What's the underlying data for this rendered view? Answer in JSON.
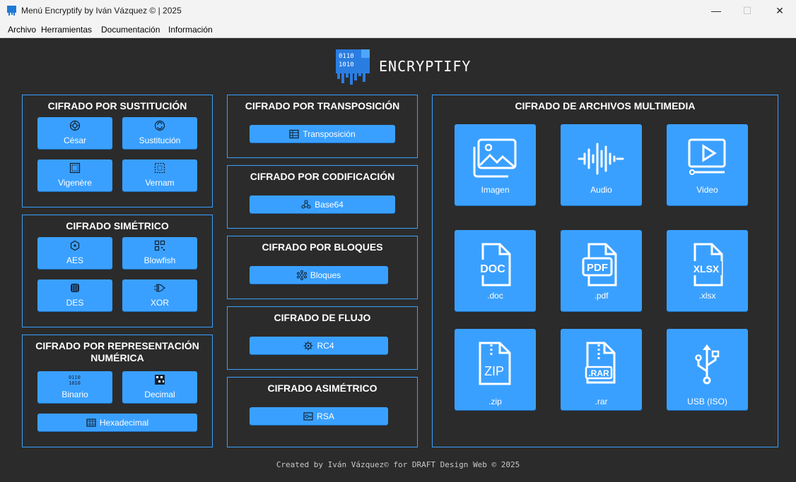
{
  "window": {
    "title": "Menú Encryptify by Iván Vázquez © | 2025",
    "minimize": "—",
    "maximize": "☐",
    "close": "✕"
  },
  "menu": [
    "Archivo",
    "Herramientas",
    "Documentación",
    "Información"
  ],
  "brand": "ENCRYPTIFY",
  "panels": {
    "sustitucion": {
      "title": "CIFRADO POR SUSTITUCIÓN",
      "buttons": [
        "César",
        "Sustitución",
        "Vigenère",
        "Vernam"
      ]
    },
    "simetrico": {
      "title": "CIFRADO SIMÉTRICO",
      "buttons": [
        "AES",
        "Blowfish",
        "DES",
        "XOR"
      ]
    },
    "numerica": {
      "title_line1": "CIFRADO POR REPRESENTACIÓN",
      "title_line2": "NUMÉRICA",
      "buttons": [
        "Binario",
        "Decimal",
        "Hexadecimal"
      ]
    },
    "transposicion": {
      "title": "CIFRADO POR TRANSPOSICIÓN",
      "button": "Transposición"
    },
    "codificacion": {
      "title": "CIFRADO POR CODIFICACIÓN",
      "button": "Base64"
    },
    "bloques": {
      "title": "CIFRADO POR BLOQUES",
      "button": "Bloques"
    },
    "flujo": {
      "title": "CIFRADO DE FLUJO",
      "button": "RC4"
    },
    "asimetrico": {
      "title": "CIFRADO ASIMÉTRICO",
      "button": "RSA"
    },
    "multimedia": {
      "title": "CIFRADO DE ARCHIVOS MULTIMEDIA",
      "buttons": [
        "Imagen",
        "Audio",
        "Video",
        ".doc",
        ".pdf",
        ".xlsx",
        ".zip",
        ".rar",
        "USB (ISO)"
      ]
    }
  },
  "file_icon_labels": {
    "doc": "DOC",
    "pdf": "PDF",
    "xlsx": "XLSX",
    "zip": "ZIP",
    "rar": ".RAR"
  },
  "footer": "Created by Iván Vázquez© for DRAFT Design Web © 2025",
  "colors": {
    "accent": "#3aa0ff",
    "background": "#2b2b2b",
    "titlebar": "#f3f3f3"
  }
}
